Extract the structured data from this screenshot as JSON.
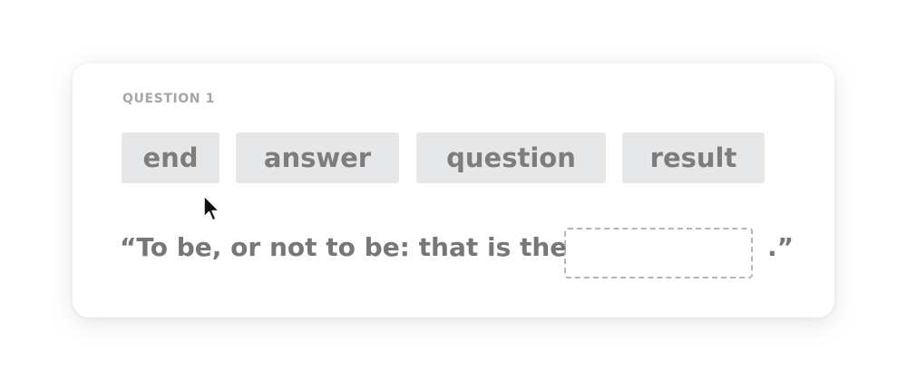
{
  "question": {
    "label": "QUESTION 1"
  },
  "choices": [
    {
      "label": "end"
    },
    {
      "label": "answer"
    },
    {
      "label": "question"
    },
    {
      "label": "result"
    }
  ],
  "sentence": {
    "prefix": "“To be, or not to be: that is the",
    "blank_value": "",
    "suffix": ".”"
  },
  "colors": {
    "chip_bg": "#e6e7e9",
    "chip_text": "#7d7d7d",
    "label_text": "#a6a6a6",
    "sentence_text": "#777777",
    "blank_border": "#b5b5b5"
  },
  "icons": {
    "cursor": "mouse-pointer-icon"
  }
}
